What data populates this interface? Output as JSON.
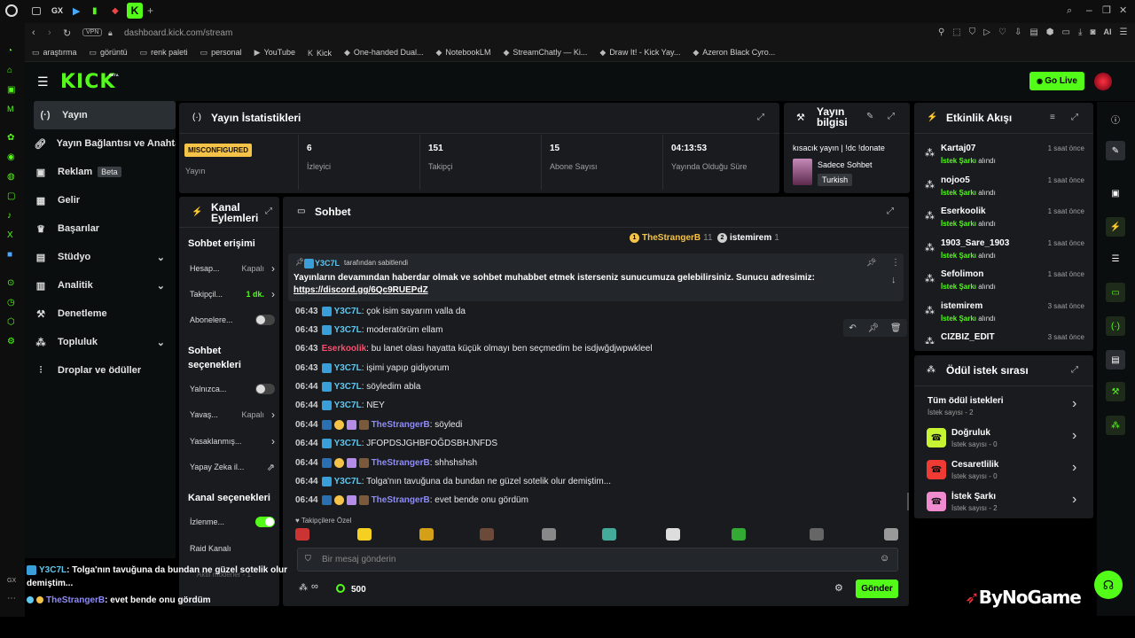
{
  "browser": {
    "url": "dashboard.kick.com/stream",
    "vpn_label": "VPN",
    "tab_gx": "GX",
    "ai_label": "AI",
    "bookmarks": [
      "araştırma",
      "görüntü",
      "renk paleti",
      "personal",
      "YouTube",
      "Kick",
      "One-handed Dual...",
      "NotebookLM",
      "StreamChatly — Ki...",
      "Draw It! - Kick Yay...",
      "Azeron Black Cyro..."
    ]
  },
  "header": {
    "logo": "KICK",
    "logo_badge": "BETA",
    "go_live": "Go Live"
  },
  "sidebar": {
    "items": [
      {
        "label": "Yayın",
        "icon": "broadcast-icon",
        "active": true
      },
      {
        "label": "Yayın Bağlantısı ve Anahtarı",
        "icon": "link-icon"
      },
      {
        "label": "Reklam",
        "icon": "ad-icon",
        "badge": "Beta"
      },
      {
        "label": "Gelir",
        "icon": "revenue-icon"
      },
      {
        "label": "Başarılar",
        "icon": "trophy-icon"
      },
      {
        "label": "Stüdyo",
        "icon": "studio-icon",
        "chevron": true
      },
      {
        "label": "Analitik",
        "icon": "analytics-icon",
        "chevron": true
      },
      {
        "label": "Denetleme",
        "icon": "moderation-icon"
      },
      {
        "label": "Topluluk",
        "icon": "community-icon",
        "chevron": true
      },
      {
        "label": "Droplar ve ödüller",
        "icon": "drops-icon"
      }
    ]
  },
  "stats": {
    "title": "Yayın İstatistikleri",
    "status_badge": "MISCONFIGURED",
    "status_label": "Yayın",
    "items": [
      {
        "value": "6",
        "label": "İzleyici"
      },
      {
        "value": "151",
        "label": "Takipçi"
      },
      {
        "value": "15",
        "label": "Abone Sayısı"
      },
      {
        "value": "04:13:53",
        "label": "Yayında Olduğu Süre"
      }
    ]
  },
  "stream_info": {
    "title": "Yayın bilgisi",
    "stream_title": "kısacık yayın | !dc !donate",
    "category": "Sadece Sohbet",
    "language": "Turkish"
  },
  "channel_actions": {
    "title": "Kanal Eylemleri",
    "chat_access": "Sohbet erişimi",
    "rows_access": [
      {
        "label": "Hesap...",
        "value": "Kapalı",
        "type": "chevron"
      },
      {
        "label": "Takipçil...",
        "value": "1 dk.",
        "type": "chevron",
        "accent": true
      },
      {
        "label": "Abonelere...",
        "type": "toggle",
        "on": false
      }
    ],
    "chat_options": "Sohbet seçenekleri",
    "rows_options": [
      {
        "label": "Yalnızca...",
        "type": "toggle",
        "on": false
      },
      {
        "label": "Yavaş...",
        "value": "Kapalı",
        "type": "chevron"
      },
      {
        "label": "Yasaklanmış...",
        "type": "chevron"
      },
      {
        "label": "Yapay Zeka il...",
        "type": "external"
      }
    ],
    "channel_options": "Kanal seçenekleri",
    "rows_channel": [
      {
        "label": "İzlenme...",
        "type": "toggle",
        "on": true
      },
      {
        "label": "Raid Kanalı",
        "type": "none"
      }
    ],
    "footer_hint": "Aktif moderler - 1"
  },
  "chat": {
    "title": "Sohbet",
    "top_users": [
      {
        "rank": "1",
        "name": "TheStrangerB",
        "count": "11",
        "color": "#f5c347"
      },
      {
        "rank": "2",
        "name": "istemirem",
        "count": "1",
        "color": "#cfcfcf"
      }
    ],
    "pinned_by_user": "Y3C7L",
    "pinned_by_suffix": "tarafından sabitlendi",
    "pinned_text": "Yayınların devamından haberdar olmak ve sohbet muhabbet etmek isterseniz sunucumuza gelebilirsiniz. Sunucu adresimiz:",
    "pinned_link": "https://discord.gg/6Qc9RUEPdZ",
    "messages": [
      {
        "time": "06:43",
        "user": "Y3C7L",
        "color": "#5ec8f0",
        "text": "çok isim sayarım valla da",
        "badges": "mod"
      },
      {
        "time": "06:43",
        "user": "Y3C7L",
        "color": "#5ec8f0",
        "text": "moderatörüm ellam",
        "badges": "mod"
      },
      {
        "time": "06:43",
        "user": "Eserkoolik",
        "color": "#ff4d6d",
        "text": "bu lanet olası hayatta küçük olmayı ben seçmedim be isdjwğdjwpwkleel",
        "badges": "none"
      },
      {
        "time": "06:43",
        "user": "Y3C7L",
        "color": "#5ec8f0",
        "text": "işimi yapıp gidiyorum",
        "badges": "mod"
      },
      {
        "time": "06:44",
        "user": "Y3C7L",
        "color": "#5ec8f0",
        "text": "söyledim abla",
        "badges": "mod"
      },
      {
        "time": "06:44",
        "user": "Y3C7L",
        "color": "#5ec8f0",
        "text": "NEY",
        "badges": "mod"
      },
      {
        "time": "06:44",
        "user": "TheStrangerB",
        "color": "#8f8cf8",
        "text": "söyledi",
        "badges": "multi"
      },
      {
        "time": "06:44",
        "user": "Y3C7L",
        "color": "#5ec8f0",
        "text": "JFOPDSJGHBFOĞDSBHJNFDS",
        "badges": "mod"
      },
      {
        "time": "06:44",
        "user": "TheStrangerB",
        "color": "#8f8cf8",
        "text": "shhshshsh",
        "badges": "multi"
      },
      {
        "time": "06:44",
        "user": "Y3C7L",
        "color": "#5ec8f0",
        "text": "Tolga'nın tavuğuna da bundan ne güzel sotelik olur demiştim...",
        "badges": "mod"
      },
      {
        "time": "06:44",
        "user": "TheStrangerB",
        "color": "#8f8cf8",
        "text": "evet bende onu gördüm",
        "badges": "multi"
      }
    ],
    "emote_section": "Takipçilere Özel",
    "input_placeholder": "Bir mesaj gönderin",
    "points": "500",
    "send": "Gönder"
  },
  "activity": {
    "title": "Etkinlik Akışı",
    "action_label": "İstek Şarkı",
    "action_suffix": "alındı",
    "items": [
      {
        "name": "Kartaj07",
        "time": "1 saat önce"
      },
      {
        "name": "nojoo5",
        "time": "1 saat önce"
      },
      {
        "name": "Eserkoolik",
        "time": "1 saat önce"
      },
      {
        "name": "1903_Sare_1903",
        "time": "1 saat önce"
      },
      {
        "name": "Sefolimon",
        "time": "1 saat önce"
      },
      {
        "name": "istemirem",
        "time": "3 saat önce"
      },
      {
        "name": "CIZBIZ_EDIT",
        "time": "3 saat önce"
      }
    ]
  },
  "rewards": {
    "title": "Ödül istek sırası",
    "items": [
      {
        "name": "Tüm ödül istekleri",
        "count": "İstek sayısı - 2",
        "color": ""
      },
      {
        "name": "Doğruluk",
        "count": "İstek sayısı - 0",
        "color": "#c6f432"
      },
      {
        "name": "Cesaretlilik",
        "count": "İstek sayısı - 0",
        "color": "#ef3b33"
      },
      {
        "name": "İstek Şarkı",
        "count": "İstek sayısı - 2",
        "color": "#f08bd0"
      }
    ]
  },
  "overlay": {
    "line1_user": "Y3C7L",
    "line1_text": ": Tolga'nın tavuğuna da bundan ne güzel sotelik olur demiştim...",
    "line2_user": "TheStrangerB",
    "line2_text": ": evet bende onu gördüm",
    "watermark": "ByNoGame"
  },
  "colors": {
    "accent": "#53fc18",
    "panel": "#191b1f",
    "bg": "#000000"
  }
}
